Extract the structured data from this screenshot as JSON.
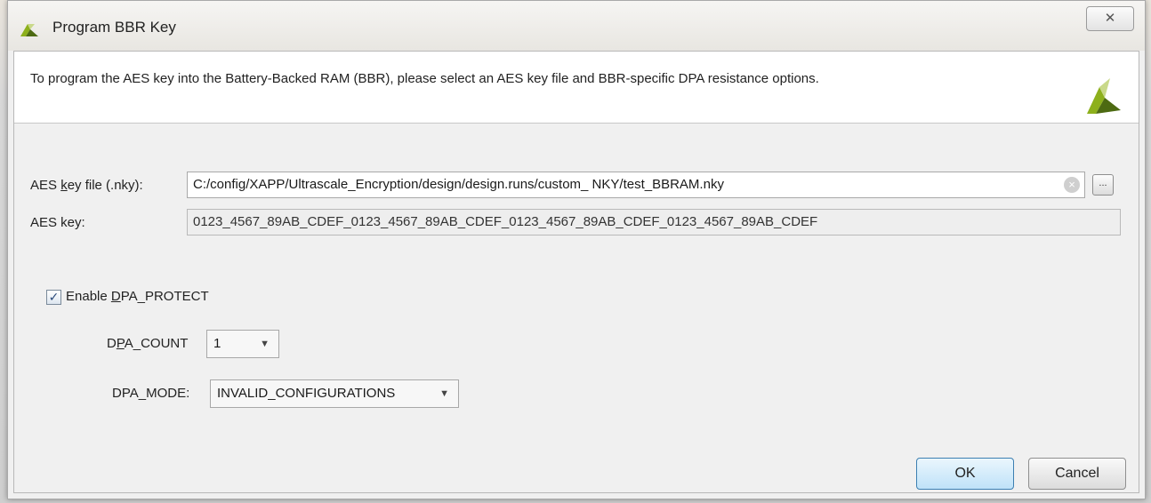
{
  "window": {
    "title": "Program BBR Key",
    "close_glyph": "✕"
  },
  "banner": {
    "text": "To program the AES key into the Battery-Backed RAM (BBR), please select an AES key file and BBR-specific DPA resistance options."
  },
  "form": {
    "key_file_label_pre": "AES ",
    "key_file_label_u": "k",
    "key_file_label_post": "ey file (.nky):",
    "key_file_value": "C:/config/XAPP/Ultrascale_Encryption/design/design.runs/custom_ NKY/test_BBRAM.nky",
    "browse_label": "...",
    "aes_key_label": "AES key:",
    "aes_key_value": "0123_4567_89AB_CDEF_0123_4567_89AB_CDEF_0123_4567_89AB_CDEF_0123_4567_89AB_CDEF"
  },
  "dpa": {
    "enable_label_pre": "Enable ",
    "enable_label_u": "D",
    "enable_label_post": "PA_PROTECT",
    "enable_checked": true,
    "check_glyph": "✓",
    "count_label_pre": "D",
    "count_label_u": "P",
    "count_label_post": "A_COUNT",
    "count_value": "1",
    "mode_label": "DPA_MODE:",
    "mode_value": "INVALID_CONFIGURATIONS",
    "arrow_glyph": "▼"
  },
  "buttons": {
    "ok": "OK",
    "cancel": "Cancel"
  },
  "colors": {
    "brand_logo": "#8db01c",
    "brand_logo_dark": "#4d6a12",
    "ok_accent": "#3c7fb1"
  },
  "icons": [
    "xilinx-logo-icon",
    "close-icon",
    "clear-icon",
    "browse-icon",
    "checkbox-check-icon",
    "dropdown-arrow-icon"
  ]
}
